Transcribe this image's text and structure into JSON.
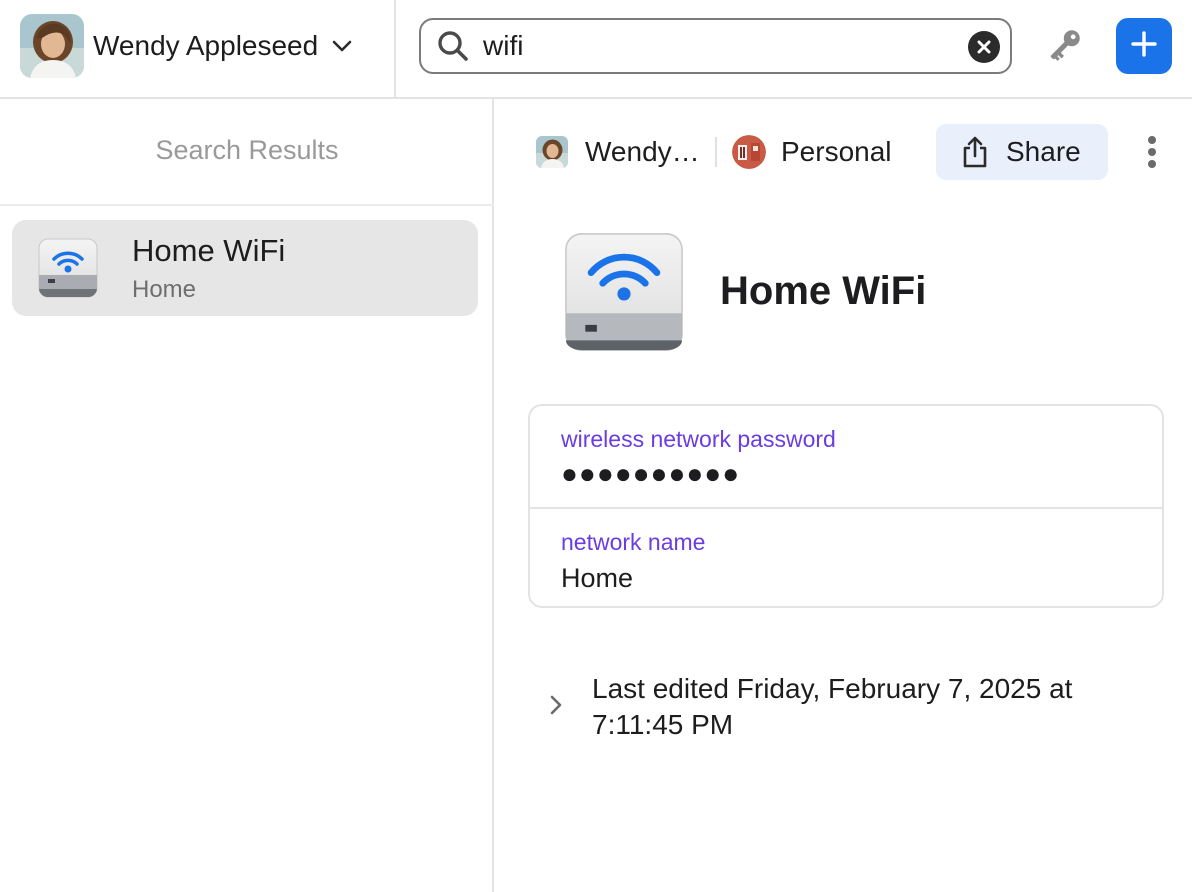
{
  "account": {
    "name": "Wendy Appleseed",
    "avatar_icon": "user-avatar-photo",
    "menu_icon": "chevron-down-icon"
  },
  "search": {
    "value": "wifi",
    "icon": "search-icon",
    "clear_icon": "clear-circle-icon"
  },
  "toolbar": {
    "key_icon": "key-icon",
    "add_icon": "plus-icon",
    "accent": "#1a73e8"
  },
  "sidebar": {
    "title": "Search Results",
    "results": [
      {
        "title": "Home WiFi",
        "subtitle": "Home",
        "icon": "wifi-router-icon",
        "selected": true
      }
    ]
  },
  "detail": {
    "owner": {
      "name": "Wendy…"
    },
    "vault": {
      "name": "Personal",
      "icon": "vault-icon"
    },
    "share_label": "Share",
    "more_icon": "more-vertical-icon",
    "item_title": "Home WiFi",
    "fields": [
      {
        "label": "wireless network password",
        "value": "●●●●●●●●●●"
      },
      {
        "label": "network name",
        "value": "Home"
      }
    ],
    "last_edited": "Last edited Friday, February 7, 2025 at 7:11:45 PM",
    "label_color": "#6b3ce2"
  }
}
